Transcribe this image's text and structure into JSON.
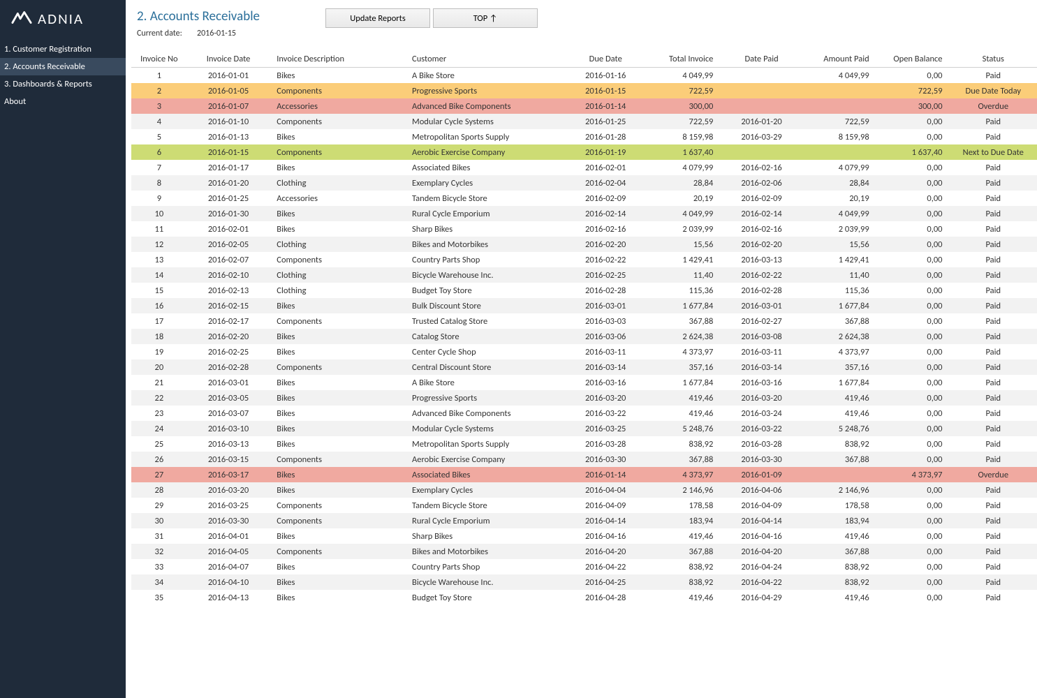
{
  "brand": "ADNIA",
  "sidebar": {
    "items": [
      {
        "label": "1. Customer Registration"
      },
      {
        "label": "2. Accounts Receivable",
        "active": true
      },
      {
        "label": "3. Dashboards & Reports"
      },
      {
        "label": "About"
      }
    ]
  },
  "header": {
    "title": "2. Accounts Receivable",
    "current_date_label": "Current date:",
    "current_date": "2016-01-15",
    "buttons": {
      "update": "Update Reports",
      "top": "TOP  ↑"
    }
  },
  "columns": [
    "Invoice No",
    "Invoice Date",
    "Invoice Description",
    "Customer",
    "Due Date",
    "Total Invoice",
    "Date Paid",
    "Amount Paid",
    "Open Balance",
    "Status"
  ],
  "status_colors": {
    "Paid": "normal",
    "Due Date Today": "due_date_today",
    "Overdue": "overdue",
    "Next to Due Date": "next_to_due_date"
  },
  "rows": [
    {
      "no": "1",
      "idate": "2016-01-01",
      "desc": "Bikes",
      "cust": "A Bike Store",
      "due": "2016-01-16",
      "total": "4 049,99",
      "paid_date": "",
      "paid_amt": "4 049,99",
      "open": "0,00",
      "status": "Paid"
    },
    {
      "no": "2",
      "idate": "2016-01-05",
      "desc": "Components",
      "cust": "Progressive Sports",
      "due": "2016-01-15",
      "total": "722,59",
      "paid_date": "",
      "paid_amt": "",
      "open": "722,59",
      "status": "Due Date Today"
    },
    {
      "no": "3",
      "idate": "2016-01-07",
      "desc": "Accessories",
      "cust": "Advanced Bike Components",
      "due": "2016-01-14",
      "total": "300,00",
      "paid_date": "",
      "paid_amt": "",
      "open": "300,00",
      "status": "Overdue"
    },
    {
      "no": "4",
      "idate": "2016-01-10",
      "desc": "Components",
      "cust": "Modular Cycle Systems",
      "due": "2016-01-25",
      "total": "722,59",
      "paid_date": "2016-01-20",
      "paid_amt": "722,59",
      "open": "0,00",
      "status": "Paid"
    },
    {
      "no": "5",
      "idate": "2016-01-13",
      "desc": "Bikes",
      "cust": "Metropolitan Sports Supply",
      "due": "2016-01-28",
      "total": "8 159,98",
      "paid_date": "2016-03-29",
      "paid_amt": "8 159,98",
      "open": "0,00",
      "status": "Paid"
    },
    {
      "no": "6",
      "idate": "2016-01-15",
      "desc": "Components",
      "cust": "Aerobic Exercise Company",
      "due": "2016-01-19",
      "total": "1 637,40",
      "paid_date": "",
      "paid_amt": "",
      "open": "1 637,40",
      "status": "Next to Due Date"
    },
    {
      "no": "7",
      "idate": "2016-01-17",
      "desc": "Bikes",
      "cust": "Associated Bikes",
      "due": "2016-02-01",
      "total": "4 079,99",
      "paid_date": "2016-02-16",
      "paid_amt": "4 079,99",
      "open": "0,00",
      "status": "Paid"
    },
    {
      "no": "8",
      "idate": "2016-01-20",
      "desc": "Clothing",
      "cust": "Exemplary Cycles",
      "due": "2016-02-04",
      "total": "28,84",
      "paid_date": "2016-02-06",
      "paid_amt": "28,84",
      "open": "0,00",
      "status": "Paid"
    },
    {
      "no": "9",
      "idate": "2016-01-25",
      "desc": "Accessories",
      "cust": "Tandem Bicycle Store",
      "due": "2016-02-09",
      "total": "20,19",
      "paid_date": "2016-02-09",
      "paid_amt": "20,19",
      "open": "0,00",
      "status": "Paid"
    },
    {
      "no": "10",
      "idate": "2016-01-30",
      "desc": "Bikes",
      "cust": "Rural Cycle Emporium",
      "due": "2016-02-14",
      "total": "4 049,99",
      "paid_date": "2016-02-14",
      "paid_amt": "4 049,99",
      "open": "0,00",
      "status": "Paid"
    },
    {
      "no": "11",
      "idate": "2016-02-01",
      "desc": "Bikes",
      "cust": "Sharp Bikes",
      "due": "2016-02-16",
      "total": "2 039,99",
      "paid_date": "2016-02-16",
      "paid_amt": "2 039,99",
      "open": "0,00",
      "status": "Paid"
    },
    {
      "no": "12",
      "idate": "2016-02-05",
      "desc": "Clothing",
      "cust": "Bikes and Motorbikes",
      "due": "2016-02-20",
      "total": "15,56",
      "paid_date": "2016-02-20",
      "paid_amt": "15,56",
      "open": "0,00",
      "status": "Paid"
    },
    {
      "no": "13",
      "idate": "2016-02-07",
      "desc": "Components",
      "cust": "Country Parts Shop",
      "due": "2016-02-22",
      "total": "1 429,41",
      "paid_date": "2016-03-13",
      "paid_amt": "1 429,41",
      "open": "0,00",
      "status": "Paid"
    },
    {
      "no": "14",
      "idate": "2016-02-10",
      "desc": "Clothing",
      "cust": "Bicycle Warehouse Inc.",
      "due": "2016-02-25",
      "total": "11,40",
      "paid_date": "2016-02-22",
      "paid_amt": "11,40",
      "open": "0,00",
      "status": "Paid"
    },
    {
      "no": "15",
      "idate": "2016-02-13",
      "desc": "Clothing",
      "cust": "Budget Toy Store",
      "due": "2016-02-28",
      "total": "115,36",
      "paid_date": "2016-02-28",
      "paid_amt": "115,36",
      "open": "0,00",
      "status": "Paid"
    },
    {
      "no": "16",
      "idate": "2016-02-15",
      "desc": "Bikes",
      "cust": "Bulk Discount Store",
      "due": "2016-03-01",
      "total": "1 677,84",
      "paid_date": "2016-03-01",
      "paid_amt": "1 677,84",
      "open": "0,00",
      "status": "Paid"
    },
    {
      "no": "17",
      "idate": "2016-02-17",
      "desc": "Components",
      "cust": "Trusted Catalog Store",
      "due": "2016-03-03",
      "total": "367,88",
      "paid_date": "2016-02-27",
      "paid_amt": "367,88",
      "open": "0,00",
      "status": "Paid"
    },
    {
      "no": "18",
      "idate": "2016-02-20",
      "desc": "Bikes",
      "cust": "Catalog Store",
      "due": "2016-03-06",
      "total": "2 624,38",
      "paid_date": "2016-03-08",
      "paid_amt": "2 624,38",
      "open": "0,00",
      "status": "Paid"
    },
    {
      "no": "19",
      "idate": "2016-02-25",
      "desc": "Bikes",
      "cust": "Center Cycle Shop",
      "due": "2016-03-11",
      "total": "4 373,97",
      "paid_date": "2016-03-11",
      "paid_amt": "4 373,97",
      "open": "0,00",
      "status": "Paid"
    },
    {
      "no": "20",
      "idate": "2016-02-28",
      "desc": "Components",
      "cust": "Central Discount Store",
      "due": "2016-03-14",
      "total": "357,16",
      "paid_date": "2016-03-14",
      "paid_amt": "357,16",
      "open": "0,00",
      "status": "Paid"
    },
    {
      "no": "21",
      "idate": "2016-03-01",
      "desc": "Bikes",
      "cust": "A Bike Store",
      "due": "2016-03-16",
      "total": "1 677,84",
      "paid_date": "2016-03-16",
      "paid_amt": "1 677,84",
      "open": "0,00",
      "status": "Paid"
    },
    {
      "no": "22",
      "idate": "2016-03-05",
      "desc": "Bikes",
      "cust": "Progressive Sports",
      "due": "2016-03-20",
      "total": "419,46",
      "paid_date": "2016-03-20",
      "paid_amt": "419,46",
      "open": "0,00",
      "status": "Paid"
    },
    {
      "no": "23",
      "idate": "2016-03-07",
      "desc": "Bikes",
      "cust": "Advanced Bike Components",
      "due": "2016-03-22",
      "total": "419,46",
      "paid_date": "2016-03-24",
      "paid_amt": "419,46",
      "open": "0,00",
      "status": "Paid"
    },
    {
      "no": "24",
      "idate": "2016-03-10",
      "desc": "Bikes",
      "cust": "Modular Cycle Systems",
      "due": "2016-03-25",
      "total": "5 248,76",
      "paid_date": "2016-03-22",
      "paid_amt": "5 248,76",
      "open": "0,00",
      "status": "Paid"
    },
    {
      "no": "25",
      "idate": "2016-03-13",
      "desc": "Bikes",
      "cust": "Metropolitan Sports Supply",
      "due": "2016-03-28",
      "total": "838,92",
      "paid_date": "2016-03-28",
      "paid_amt": "838,92",
      "open": "0,00",
      "status": "Paid"
    },
    {
      "no": "26",
      "idate": "2016-03-15",
      "desc": "Components",
      "cust": "Aerobic Exercise Company",
      "due": "2016-03-30",
      "total": "367,88",
      "paid_date": "2016-03-30",
      "paid_amt": "367,88",
      "open": "0,00",
      "status": "Paid"
    },
    {
      "no": "27",
      "idate": "2016-03-17",
      "desc": "Bikes",
      "cust": "Associated Bikes",
      "due": "2016-01-14",
      "total": "4 373,97",
      "paid_date": "2016-01-09",
      "paid_amt": "",
      "open": "4 373,97",
      "status": "Overdue"
    },
    {
      "no": "28",
      "idate": "2016-03-20",
      "desc": "Bikes",
      "cust": "Exemplary Cycles",
      "due": "2016-04-04",
      "total": "2 146,96",
      "paid_date": "2016-04-06",
      "paid_amt": "2 146,96",
      "open": "0,00",
      "status": "Paid"
    },
    {
      "no": "29",
      "idate": "2016-03-25",
      "desc": "Components",
      "cust": "Tandem Bicycle Store",
      "due": "2016-04-09",
      "total": "178,58",
      "paid_date": "2016-04-09",
      "paid_amt": "178,58",
      "open": "0,00",
      "status": "Paid"
    },
    {
      "no": "30",
      "idate": "2016-03-30",
      "desc": "Components",
      "cust": "Rural Cycle Emporium",
      "due": "2016-04-14",
      "total": "183,94",
      "paid_date": "2016-04-14",
      "paid_amt": "183,94",
      "open": "0,00",
      "status": "Paid"
    },
    {
      "no": "31",
      "idate": "2016-04-01",
      "desc": "Bikes",
      "cust": "Sharp Bikes",
      "due": "2016-04-16",
      "total": "419,46",
      "paid_date": "2016-04-16",
      "paid_amt": "419,46",
      "open": "0,00",
      "status": "Paid"
    },
    {
      "no": "32",
      "idate": "2016-04-05",
      "desc": "Components",
      "cust": "Bikes and Motorbikes",
      "due": "2016-04-20",
      "total": "367,88",
      "paid_date": "2016-04-20",
      "paid_amt": "367,88",
      "open": "0,00",
      "status": "Paid"
    },
    {
      "no": "33",
      "idate": "2016-04-07",
      "desc": "Bikes",
      "cust": "Country Parts Shop",
      "due": "2016-04-22",
      "total": "838,92",
      "paid_date": "2016-04-24",
      "paid_amt": "838,92",
      "open": "0,00",
      "status": "Paid"
    },
    {
      "no": "34",
      "idate": "2016-04-10",
      "desc": "Bikes",
      "cust": "Bicycle Warehouse Inc.",
      "due": "2016-04-25",
      "total": "838,92",
      "paid_date": "2016-04-22",
      "paid_amt": "838,92",
      "open": "0,00",
      "status": "Paid"
    },
    {
      "no": "35",
      "idate": "2016-04-13",
      "desc": "Bikes",
      "cust": "Budget Toy Store",
      "due": "2016-04-28",
      "total": "419,46",
      "paid_date": "2016-04-29",
      "paid_amt": "419,46",
      "open": "0,00",
      "status": "Paid"
    }
  ]
}
